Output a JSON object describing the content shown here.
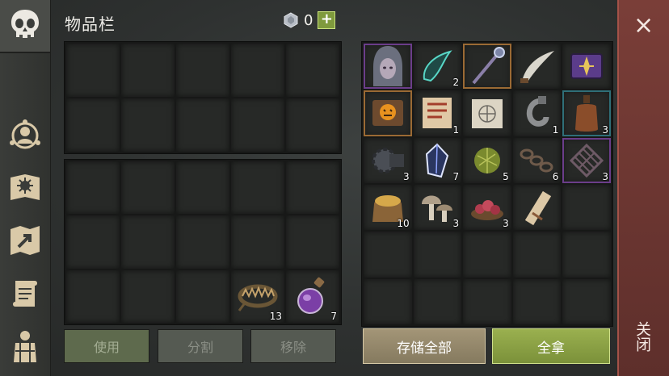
{
  "header": {
    "title": "物品栏",
    "currency_value": "0",
    "plus_label": "+"
  },
  "nav": {
    "items": [
      {
        "name": "skull-icon"
      },
      {
        "name": "character-icon"
      },
      {
        "name": "recipe-book-icon"
      },
      {
        "name": "map-icon"
      },
      {
        "name": "quest-scroll-icon"
      },
      {
        "name": "backpack-icon"
      }
    ]
  },
  "left_inventory": {
    "counts": {
      "trap": "13",
      "potion": "7"
    }
  },
  "loot": {
    "counts": {
      "claw": "2",
      "recipe_page": "1",
      "iron_hook": "1",
      "bottle": "3",
      "gear": "3",
      "crystal": "7",
      "grass_ball": "5",
      "chain": "6",
      "grate": "3",
      "grain_sack": "10",
      "mushroom": "3",
      "berries": "3"
    }
  },
  "buttons": {
    "use": "使用",
    "split": "分割",
    "remove": "移除",
    "store_all": "存储全部",
    "take_all": "全拿"
  },
  "close": {
    "label": "关闭",
    "x": "×"
  }
}
